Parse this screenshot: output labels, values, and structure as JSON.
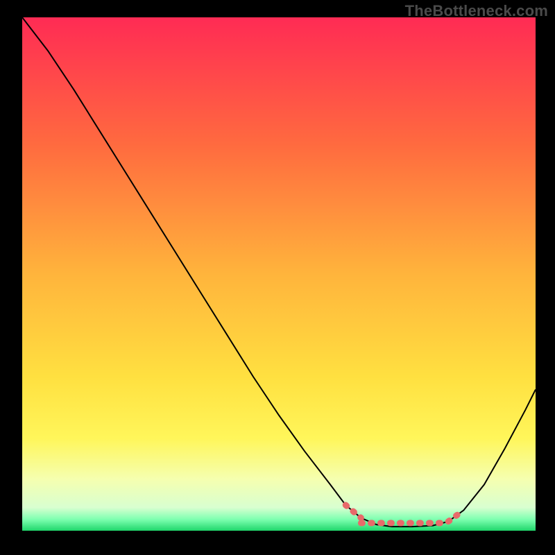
{
  "watermark": "TheBottleneck.com",
  "chart_data": {
    "type": "line",
    "title": "",
    "xlabel": "",
    "ylabel": "",
    "xlim": [
      0,
      100
    ],
    "ylim": [
      0,
      100
    ],
    "gradient_stops": [
      {
        "offset": 0,
        "color": "#ff2b54"
      },
      {
        "offset": 0.25,
        "color": "#ff6b3f"
      },
      {
        "offset": 0.5,
        "color": "#ffb43c"
      },
      {
        "offset": 0.7,
        "color": "#ffe040"
      },
      {
        "offset": 0.82,
        "color": "#fff65a"
      },
      {
        "offset": 0.9,
        "color": "#f5ffb0"
      },
      {
        "offset": 0.955,
        "color": "#d8ffd0"
      },
      {
        "offset": 0.978,
        "color": "#7dffb0"
      },
      {
        "offset": 1.0,
        "color": "#1fd66b"
      }
    ],
    "series": [
      {
        "name": "curve",
        "stroke": "#000000",
        "stroke_width": 2,
        "points": [
          {
            "x": 0.0,
            "y": 100.0
          },
          {
            "x": 5.0,
            "y": 93.5
          },
          {
            "x": 10.0,
            "y": 86.0
          },
          {
            "x": 15.0,
            "y": 78.0
          },
          {
            "x": 20.0,
            "y": 70.0
          },
          {
            "x": 25.0,
            "y": 62.0
          },
          {
            "x": 30.0,
            "y": 54.0
          },
          {
            "x": 35.0,
            "y": 46.0
          },
          {
            "x": 40.0,
            "y": 38.0
          },
          {
            "x": 45.0,
            "y": 30.0
          },
          {
            "x": 50.0,
            "y": 22.5
          },
          {
            "x": 55.0,
            "y": 15.5
          },
          {
            "x": 60.0,
            "y": 9.0
          },
          {
            "x": 63.0,
            "y": 5.0
          },
          {
            "x": 66.0,
            "y": 2.5
          },
          {
            "x": 69.0,
            "y": 1.2
          },
          {
            "x": 72.0,
            "y": 0.8
          },
          {
            "x": 76.0,
            "y": 0.8
          },
          {
            "x": 80.0,
            "y": 1.0
          },
          {
            "x": 83.0,
            "y": 1.8
          },
          {
            "x": 86.0,
            "y": 4.0
          },
          {
            "x": 90.0,
            "y": 9.0
          },
          {
            "x": 94.0,
            "y": 16.0
          },
          {
            "x": 98.0,
            "y": 23.5
          },
          {
            "x": 100.0,
            "y": 27.5
          }
        ]
      },
      {
        "name": "highlight-left",
        "stroke": "#e86a6a",
        "stroke_width": 9,
        "stroke_dasharray": "2 12",
        "linecap": "round",
        "points": [
          {
            "x": 63.0,
            "y": 5.0
          },
          {
            "x": 66.0,
            "y": 2.5
          }
        ]
      },
      {
        "name": "highlight-flat",
        "stroke": "#e86a6a",
        "stroke_width": 9,
        "stroke_dasharray": "2 12",
        "linecap": "round",
        "points": [
          {
            "x": 66.0,
            "y": 1.5
          },
          {
            "x": 83.0,
            "y": 1.5
          }
        ]
      },
      {
        "name": "highlight-right",
        "stroke": "#e86a6a",
        "stroke_width": 9,
        "stroke_dasharray": "2 12",
        "linecap": "round",
        "points": [
          {
            "x": 83.0,
            "y": 1.8
          },
          {
            "x": 86.0,
            "y": 4.0
          }
        ]
      }
    ]
  }
}
